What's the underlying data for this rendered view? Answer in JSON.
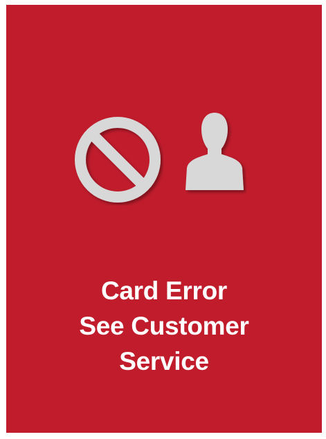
{
  "screen": {
    "background_color": "#c01c2c",
    "icon_color": "#d8d8d8",
    "icons": [
      "prohibited-icon",
      "person-icon"
    ],
    "message": {
      "line1": "Card Error",
      "line2": "See Customer",
      "line3": "Service"
    }
  }
}
